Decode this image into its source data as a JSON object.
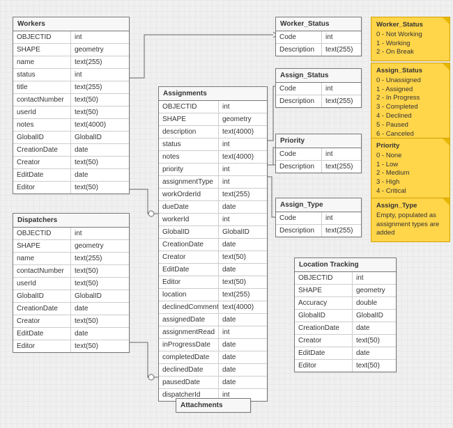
{
  "entities": {
    "workers": {
      "title": "Workers",
      "fields": [
        [
          "OBJECTID",
          "int"
        ],
        [
          "SHAPE",
          "geometry"
        ],
        [
          "name",
          "text(255)"
        ],
        [
          "status",
          "int"
        ],
        [
          "title",
          "text(255)"
        ],
        [
          "contactNumber",
          "text(50)"
        ],
        [
          "userId",
          "text(50)"
        ],
        [
          "notes",
          "text(4000)"
        ],
        [
          "GlobalID",
          "GlobalID"
        ],
        [
          "CreationDate",
          "date"
        ],
        [
          "Creator",
          "text(50)"
        ],
        [
          "EditDate",
          "date"
        ],
        [
          "Editor",
          "text(50)"
        ]
      ]
    },
    "dispatchers": {
      "title": "Dispatchers",
      "fields": [
        [
          "OBJECTID",
          "int"
        ],
        [
          "SHAPE",
          "geometry"
        ],
        [
          "name",
          "text(255)"
        ],
        [
          "contactNumber",
          "text(50)"
        ],
        [
          "userId",
          "text(50)"
        ],
        [
          "GlobalID",
          "GlobalID"
        ],
        [
          "CreationDate",
          "date"
        ],
        [
          "Creator",
          "text(50)"
        ],
        [
          "EditDate",
          "date"
        ],
        [
          "Editor",
          "text(50)"
        ]
      ]
    },
    "assignments": {
      "title": "Assignments",
      "fields": [
        [
          "OBJECTID",
          "int"
        ],
        [
          "SHAPE",
          "geometry"
        ],
        [
          "description",
          "text(4000)"
        ],
        [
          "status",
          "int"
        ],
        [
          "notes",
          "text(4000)"
        ],
        [
          "priority",
          "int"
        ],
        [
          "assignmentType",
          "int"
        ],
        [
          "workOrderId",
          "text(255)"
        ],
        [
          "dueDate",
          "date"
        ],
        [
          "workerId",
          "int"
        ],
        [
          "GlobalID",
          "GlobalID"
        ],
        [
          "CreationDate",
          "date"
        ],
        [
          "Creator",
          "text(50)"
        ],
        [
          "EditDate",
          "date"
        ],
        [
          "Editor",
          "text(50)"
        ],
        [
          "location",
          "text(255)"
        ],
        [
          "declinedComment",
          "text(4000)"
        ],
        [
          "assignedDate",
          "date"
        ],
        [
          "assignmentRead",
          "int"
        ],
        [
          "inProgressDate",
          "date"
        ],
        [
          "completedDate",
          "date"
        ],
        [
          "declinedDate",
          "date"
        ],
        [
          "pausedDate",
          "date"
        ],
        [
          "dispatcherId",
          "int"
        ]
      ]
    },
    "worker_status": {
      "title": "Worker_Status",
      "fields": [
        [
          "Code",
          "int"
        ],
        [
          "Description",
          "text(255)"
        ]
      ]
    },
    "assign_status": {
      "title": "Assign_Status",
      "fields": [
        [
          "Code",
          "int"
        ],
        [
          "Description",
          "text(255)"
        ]
      ]
    },
    "priority": {
      "title": "Priority",
      "fields": [
        [
          "Code",
          "int"
        ],
        [
          "Description",
          "text(255)"
        ]
      ]
    },
    "assign_type": {
      "title": "Assign_Type",
      "fields": [
        [
          "Code",
          "int"
        ],
        [
          "Description",
          "text(255)"
        ]
      ]
    },
    "location_tracking": {
      "title": "Location Tracking",
      "fields": [
        [
          "OBJECTID",
          "int"
        ],
        [
          "SHAPE",
          "geometry"
        ],
        [
          "Accuracy",
          "double"
        ],
        [
          "GlobalID",
          "GlobalID"
        ],
        [
          "CreationDate",
          "date"
        ],
        [
          "Creator",
          "text(50)"
        ],
        [
          "EditDate",
          "date"
        ],
        [
          "Editor",
          "text(50)"
        ]
      ]
    },
    "attachments": {
      "title": "Attachments"
    }
  },
  "notes": {
    "worker_status": {
      "title": "Worker_Status",
      "lines": [
        "0 - Not Working",
        "1 - Working",
        "2 - On Break"
      ]
    },
    "assign_status": {
      "title": "Assign_Status",
      "lines": [
        "0 - Unassigned",
        "1 - Assigned",
        "2 - In Progress",
        "3 - Completed",
        "4 - Declined",
        "5 - Paused",
        "6 - Canceled"
      ]
    },
    "priority": {
      "title": "Priority",
      "lines": [
        "0 - None",
        "1 - Low",
        "2 - Medium",
        "3 - High",
        "4 - Critical"
      ]
    },
    "assign_type": {
      "title": "Assign_Type",
      "lines": [
        "Empty, populated as",
        "assignment types are added"
      ]
    }
  }
}
